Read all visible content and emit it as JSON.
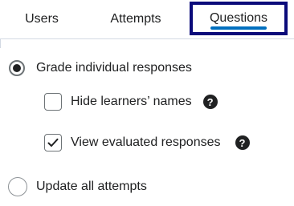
{
  "tabs": [
    {
      "label": "Users"
    },
    {
      "label": "Attempts"
    },
    {
      "label": "Questions",
      "selected": true
    }
  ],
  "options": {
    "grade_individual": {
      "label": "Grade individual responses",
      "selected": true
    },
    "hide_names": {
      "label": "Hide learners’ names",
      "checked": false,
      "help_icon": "question-circle-icon"
    },
    "view_evaluated": {
      "label": "View evaluated responses",
      "checked": true,
      "help_icon": "question-circle-icon"
    },
    "update_all": {
      "label": "Update all attempts",
      "selected": false
    }
  },
  "colors": {
    "focus_ring": "#0b0b7a",
    "tab_underline": "#006fbf",
    "text": "#202122"
  }
}
